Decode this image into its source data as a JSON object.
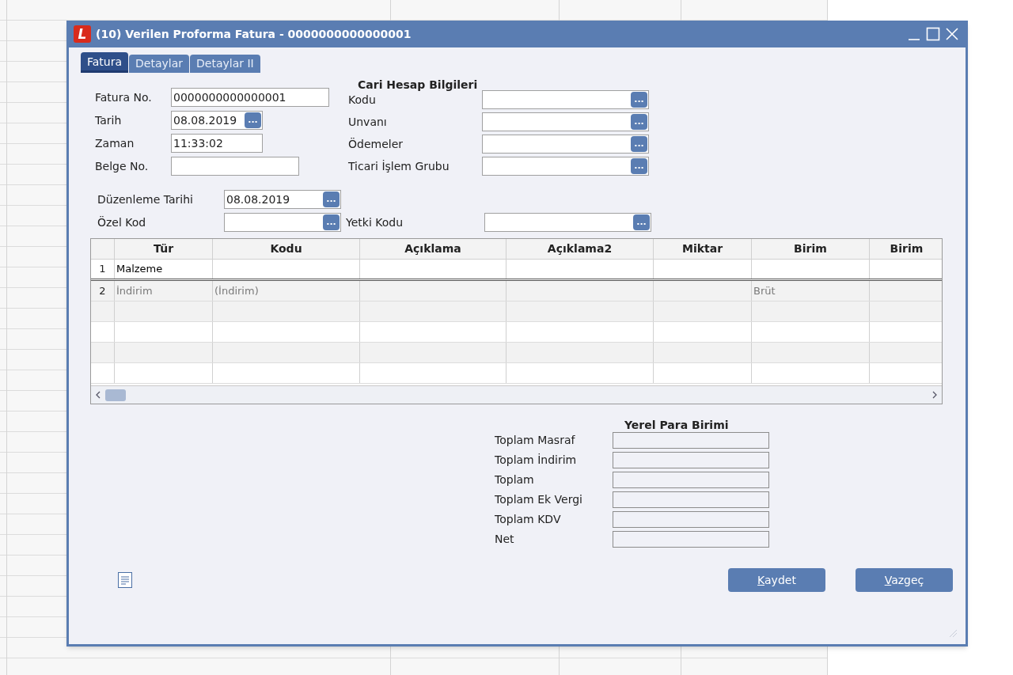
{
  "window": {
    "logo_letter": "L",
    "title": "(10) Verilen Proforma Fatura - 0000000000000001"
  },
  "tabs": [
    {
      "label": "Fatura",
      "selected": true
    },
    {
      "label": "Detaylar",
      "selected": false
    },
    {
      "label": "Detaylar II",
      "selected": false
    }
  ],
  "invoice_fields": [
    {
      "label": "Fatura No.",
      "value": "0000000000000001"
    },
    {
      "label": "Tarih",
      "value": "08.08.2019",
      "button": "..."
    },
    {
      "label": "Zaman",
      "value": "11:33:02"
    },
    {
      "label": "Belge No."
    }
  ],
  "account_section": {
    "title": "Cari Hesap Bilgileri",
    "fields": [
      {
        "label": "Kodu",
        "button": "..."
      },
      {
        "label": "Unvanı",
        "button": "..."
      },
      {
        "label": "Ödemeler",
        "button": "..."
      },
      {
        "label": "Ticari İşlem Grubu",
        "button": "..."
      }
    ]
  },
  "edit_date": {
    "label": "Düzenleme Tarihi",
    "value": "08.08.2019",
    "button": "..."
  },
  "special_code": {
    "label": "Özel Kod",
    "button": "..."
  },
  "auth_code": {
    "label": "Yetki Kodu",
    "button": "..."
  },
  "table": {
    "columns": [
      "Tür",
      "Kodu",
      "Açıklama",
      "Açıklama2",
      "Miktar",
      "Birim",
      "Birim"
    ],
    "rows": [
      {
        "number": "1",
        "cells": [
          "Malzeme",
          null,
          null,
          null,
          null,
          null,
          null
        ],
        "dimmed": false
      },
      {
        "number": "2",
        "cells": [
          "İndirim",
          "(İndirim)",
          null,
          null,
          null,
          "Brüt",
          null
        ],
        "dimmed": true
      }
    ]
  },
  "totals": {
    "title": "Yerel Para Birimi",
    "fields": [
      {
        "label": "Toplam Masraf"
      },
      {
        "label": "Toplam İndirim"
      },
      {
        "label": "Toplam"
      },
      {
        "label": "Toplam Ek Vergi"
      },
      {
        "label": "Toplam KDV"
      },
      {
        "label": "Net"
      }
    ]
  },
  "buttons": [
    {
      "label_parts": [
        {
          "text": "K",
          "underlined": true
        },
        {
          "text": "aydet",
          "underlined": false
        }
      ]
    },
    {
      "label_parts": [
        {
          "text": "V",
          "underlined": true
        },
        {
          "text": "azgeç",
          "underlined": false
        }
      ]
    }
  ]
}
